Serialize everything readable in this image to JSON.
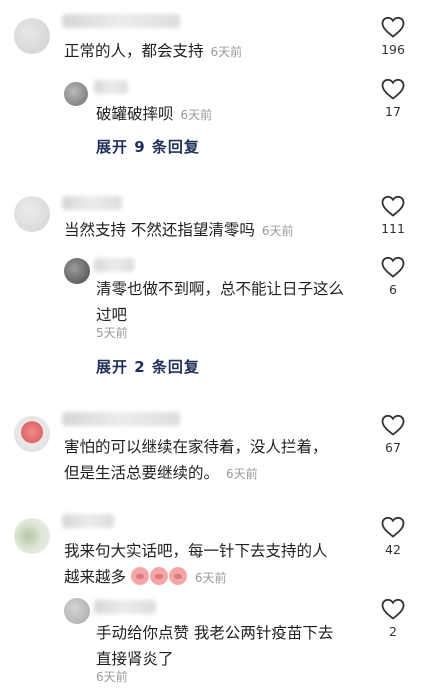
{
  "comments": [
    {
      "text": "正常的人，都会支持",
      "time": "6天前",
      "likes": "196",
      "reply": {
        "text": "破罐破摔呗",
        "time": "6天前",
        "likes": "17"
      },
      "expand": "展开 9 条回复"
    },
    {
      "text": "当然支持 不然还指望清零吗",
      "time": "6天前",
      "likes": "111",
      "reply": {
        "line1": "清零也做不到啊，总不能让日子这么",
        "line2": "过吧",
        "time": "5天前",
        "likes": "6"
      },
      "expand": "展开 2 条回复"
    },
    {
      "line1": "害怕的可以继续在家待着，没人拦着，",
      "line2": "但是生活总要继续的。",
      "time": "6天前",
      "likes": "67"
    },
    {
      "line1": "我来句大实话吧，每一针下去支持的人",
      "line2": "越来越多",
      "emoji": "pig-face",
      "time": "6天前",
      "likes": "42",
      "reply": {
        "line1": "手动给你点赞 我老公两针疫苗下去",
        "line2": "直接肾炎了",
        "time": "6天前",
        "likes": "2"
      }
    }
  ],
  "icons": {
    "like": "heart-outline-icon"
  }
}
